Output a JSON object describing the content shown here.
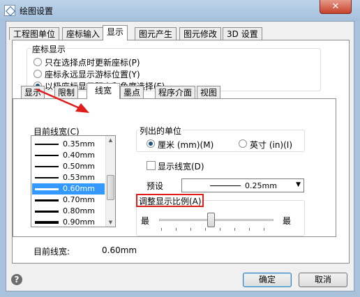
{
  "window": {
    "title": "绘图设置",
    "close_label": "✕"
  },
  "tabs": [
    {
      "label": "工程图单位"
    },
    {
      "label": "座标输入"
    },
    {
      "label": "显示"
    },
    {
      "label": "图元产生"
    },
    {
      "label": "图元修改"
    },
    {
      "label": "3D 设置"
    }
  ],
  "coord_display": {
    "label": "座标显示",
    "options": [
      {
        "label": "只在选择点时更新座标(P)",
        "selected": false
      },
      {
        "label": "座标永远显示游标位置(Y)",
        "selected": false
      },
      {
        "label": "以极座标显示距离和角度选择(F)",
        "selected": true
      }
    ]
  },
  "subtabs": [
    {
      "label": "显示"
    },
    {
      "label": "限制"
    },
    {
      "label": "线宽"
    },
    {
      "label": "墨点"
    },
    {
      "label": "程序介面"
    },
    {
      "label": "视图"
    }
  ],
  "lineweight": {
    "list_label": "目前线宽(C)",
    "items": [
      {
        "value": "0.35mm",
        "thickness": 2
      },
      {
        "value": "0.40mm",
        "thickness": 2
      },
      {
        "value": "0.50mm",
        "thickness": 2
      },
      {
        "value": "0.53mm",
        "thickness": 2
      },
      {
        "value": "0.60mm",
        "thickness": 3,
        "selected": true
      },
      {
        "value": "0.70mm",
        "thickness": 3
      },
      {
        "value": "0.80mm",
        "thickness": 3
      },
      {
        "value": "0.90mm",
        "thickness": 4
      }
    ],
    "current_label": "目前线宽:",
    "current_value": "0.60mm"
  },
  "units": {
    "label": "列出的单位",
    "mm_label": "厘米 (mm)(M)",
    "mm_selected": true,
    "inch_label": "英寸 (in)(I)",
    "inch_selected": false
  },
  "show_lineweight": {
    "label": "显示线宽(D)",
    "checked": false
  },
  "preset": {
    "label": "预设",
    "value": "0.25mm"
  },
  "scale": {
    "label": "调整显示比例(A)",
    "min_label": "最",
    "max_label": "最",
    "value_fraction": 0.45
  },
  "buttons": {
    "ok": "确定",
    "cancel": "取消",
    "help": "?"
  },
  "colors": {
    "highlight_box": "#e21b1b",
    "annotation_arrow": "#e21b1b",
    "selection": "#3399ff"
  }
}
